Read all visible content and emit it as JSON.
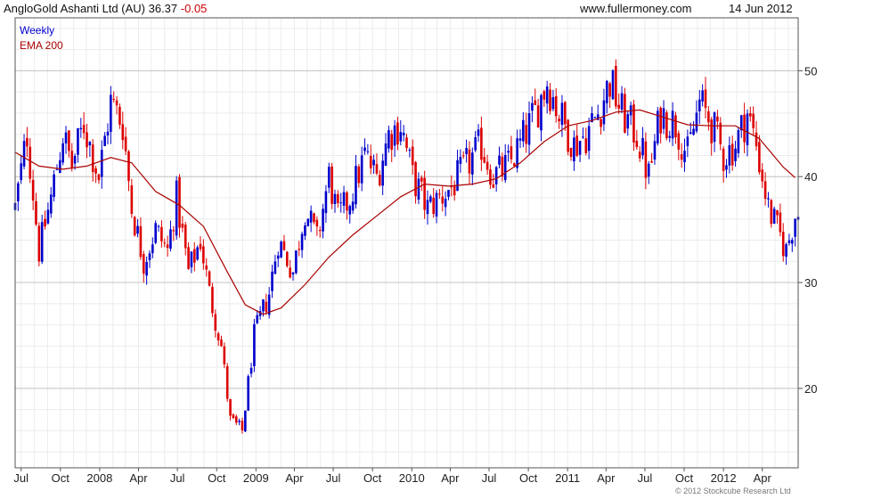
{
  "header": {
    "name": "AngloGold Ashanti Ltd (AU)",
    "price": "36.37",
    "change": "-0.05",
    "site": "www.fullermoney.com",
    "date": "14 Jun 2012"
  },
  "legend": {
    "period": "Weekly",
    "ema": "EMA 200"
  },
  "copyright": "© 2012 Stockcube Research Ltd",
  "colors": {
    "up": "#0000cc",
    "down": "#dd0000",
    "ema": "#aa0000",
    "grid": "#dddddd",
    "frame": "#555555"
  },
  "chart_data": {
    "type": "candlestick",
    "title": "AngloGold Ashanti Ltd (AU) 36.37 -0.05",
    "period": "Weekly",
    "ylim": [
      12.5,
      55
    ],
    "y_ticks": [
      20,
      30,
      40,
      50
    ],
    "y_axis_side": "right",
    "grid": true,
    "legend_position": "top-left",
    "x_ticks": [
      {
        "label": "Jul",
        "date": "2007-07-01"
      },
      {
        "label": "Oct",
        "date": "2007-10-01"
      },
      {
        "label": "2008",
        "date": "2008-01-01"
      },
      {
        "label": "Apr",
        "date": "2008-04-01"
      },
      {
        "label": "Jul",
        "date": "2008-07-01"
      },
      {
        "label": "Oct",
        "date": "2008-10-01"
      },
      {
        "label": "2009",
        "date": "2009-01-01"
      },
      {
        "label": "Apr",
        "date": "2009-04-01"
      },
      {
        "label": "Jul",
        "date": "2009-07-01"
      },
      {
        "label": "Oct",
        "date": "2009-10-01"
      },
      {
        "label": "2010",
        "date": "2010-01-01"
      },
      {
        "label": "Apr",
        "date": "2010-04-01"
      },
      {
        "label": "Jul",
        "date": "2010-07-01"
      },
      {
        "label": "Oct",
        "date": "2010-10-01"
      },
      {
        "label": "2011",
        "date": "2011-01-01"
      },
      {
        "label": "Apr",
        "date": "2011-04-01"
      },
      {
        "label": "Jul",
        "date": "2011-07-01"
      },
      {
        "label": "Oct",
        "date": "2011-10-01"
      },
      {
        "label": "2012",
        "date": "2012-01-01"
      },
      {
        "label": "Apr",
        "date": "2012-04-01"
      }
    ],
    "x_range": [
      "2007-06-17",
      "2012-06-24"
    ],
    "price_path": [
      [
        "2007-06-17",
        37
      ],
      [
        "2007-07-15",
        44
      ],
      [
        "2007-08-12",
        33
      ],
      [
        "2007-09-09",
        38
      ],
      [
        "2007-10-07",
        44
      ],
      [
        "2007-10-28",
        41
      ],
      [
        "2007-11-25",
        45
      ],
      [
        "2007-12-30",
        40
      ],
      [
        "2008-01-27",
        47
      ],
      [
        "2008-02-24",
        45
      ],
      [
        "2008-03-16",
        37
      ],
      [
        "2008-04-13",
        32
      ],
      [
        "2008-05-11",
        35
      ],
      [
        "2008-06-08",
        33
      ],
      [
        "2008-06-29",
        38
      ],
      [
        "2008-07-27",
        31
      ],
      [
        "2008-08-24",
        34
      ],
      [
        "2008-09-14",
        29
      ],
      [
        "2008-10-12",
        24
      ],
      [
        "2008-11-02",
        17
      ],
      [
        "2008-11-30",
        16
      ],
      [
        "2008-12-28",
        25
      ],
      [
        "2009-02-01",
        29
      ],
      [
        "2009-02-22",
        34
      ],
      [
        "2009-03-29",
        31
      ],
      [
        "2009-04-26",
        37
      ],
      [
        "2009-05-24",
        34
      ],
      [
        "2009-06-21",
        40
      ],
      [
        "2009-07-12",
        36
      ],
      [
        "2009-08-09",
        38
      ],
      [
        "2009-09-13",
        42
      ],
      [
        "2009-10-11",
        40
      ],
      [
        "2009-11-08",
        44
      ],
      [
        "2009-12-06",
        45
      ],
      [
        "2010-01-03",
        40
      ],
      [
        "2010-02-07",
        37
      ],
      [
        "2010-03-07",
        38
      ],
      [
        "2010-04-04",
        39
      ],
      [
        "2010-05-09",
        41
      ],
      [
        "2010-06-13",
        43
      ],
      [
        "2010-07-11",
        40
      ],
      [
        "2010-08-15",
        41
      ],
      [
        "2010-09-12",
        43
      ],
      [
        "2010-10-17",
        46
      ],
      [
        "2010-11-14",
        49
      ],
      [
        "2010-12-12",
        46
      ],
      [
        "2011-01-16",
        43
      ],
      [
        "2011-02-13",
        44
      ],
      [
        "2011-03-13",
        46
      ],
      [
        "2011-04-10",
        49
      ],
      [
        "2011-05-08",
        46
      ],
      [
        "2011-06-12",
        44
      ],
      [
        "2011-07-10",
        40
      ],
      [
        "2011-08-07",
        46
      ],
      [
        "2011-09-11",
        45
      ],
      [
        "2011-10-09",
        42
      ],
      [
        "2011-11-06",
        47
      ],
      [
        "2011-12-04",
        45
      ],
      [
        "2012-01-01",
        42
      ],
      [
        "2012-01-29",
        43
      ],
      [
        "2012-02-26",
        46
      ],
      [
        "2012-03-18",
        43
      ],
      [
        "2012-04-15",
        37
      ],
      [
        "2012-05-06",
        35
      ],
      [
        "2012-05-27",
        33
      ],
      [
        "2012-06-17",
        36.4
      ]
    ],
    "series": [
      {
        "name": "EMA 200",
        "type": "line",
        "points": [
          [
            "2007-06-17",
            42.3
          ],
          [
            "2007-08-12",
            41.0
          ],
          [
            "2007-10-07",
            40.7
          ],
          [
            "2007-12-02",
            41.0
          ],
          [
            "2008-01-27",
            41.8
          ],
          [
            "2008-03-16",
            41.3
          ],
          [
            "2008-05-11",
            38.6
          ],
          [
            "2008-07-06",
            37.3
          ],
          [
            "2008-08-31",
            35.3
          ],
          [
            "2008-10-26",
            31.0
          ],
          [
            "2008-12-07",
            27.9
          ],
          [
            "2009-01-18",
            27.0
          ],
          [
            "2009-03-01",
            27.6
          ],
          [
            "2009-04-26",
            29.8
          ],
          [
            "2009-06-21",
            32.4
          ],
          [
            "2009-08-16",
            34.5
          ],
          [
            "2009-10-11",
            36.3
          ],
          [
            "2009-12-06",
            38.1
          ],
          [
            "2010-01-31",
            39.3
          ],
          [
            "2010-03-28",
            39.1
          ],
          [
            "2010-05-23",
            39.3
          ],
          [
            "2010-07-18",
            39.8
          ],
          [
            "2010-09-12",
            41.3
          ],
          [
            "2010-11-07",
            43.3
          ],
          [
            "2011-01-02",
            44.8
          ],
          [
            "2011-02-27",
            45.3
          ],
          [
            "2011-04-24",
            46.1
          ],
          [
            "2011-06-19",
            46.3
          ],
          [
            "2011-08-14",
            45.6
          ],
          [
            "2011-10-09",
            44.9
          ],
          [
            "2011-12-04",
            44.8
          ],
          [
            "2012-01-29",
            44.8
          ],
          [
            "2012-03-25",
            43.6
          ],
          [
            "2012-05-20",
            40.9
          ],
          [
            "2012-06-17",
            39.9
          ]
        ]
      }
    ]
  }
}
